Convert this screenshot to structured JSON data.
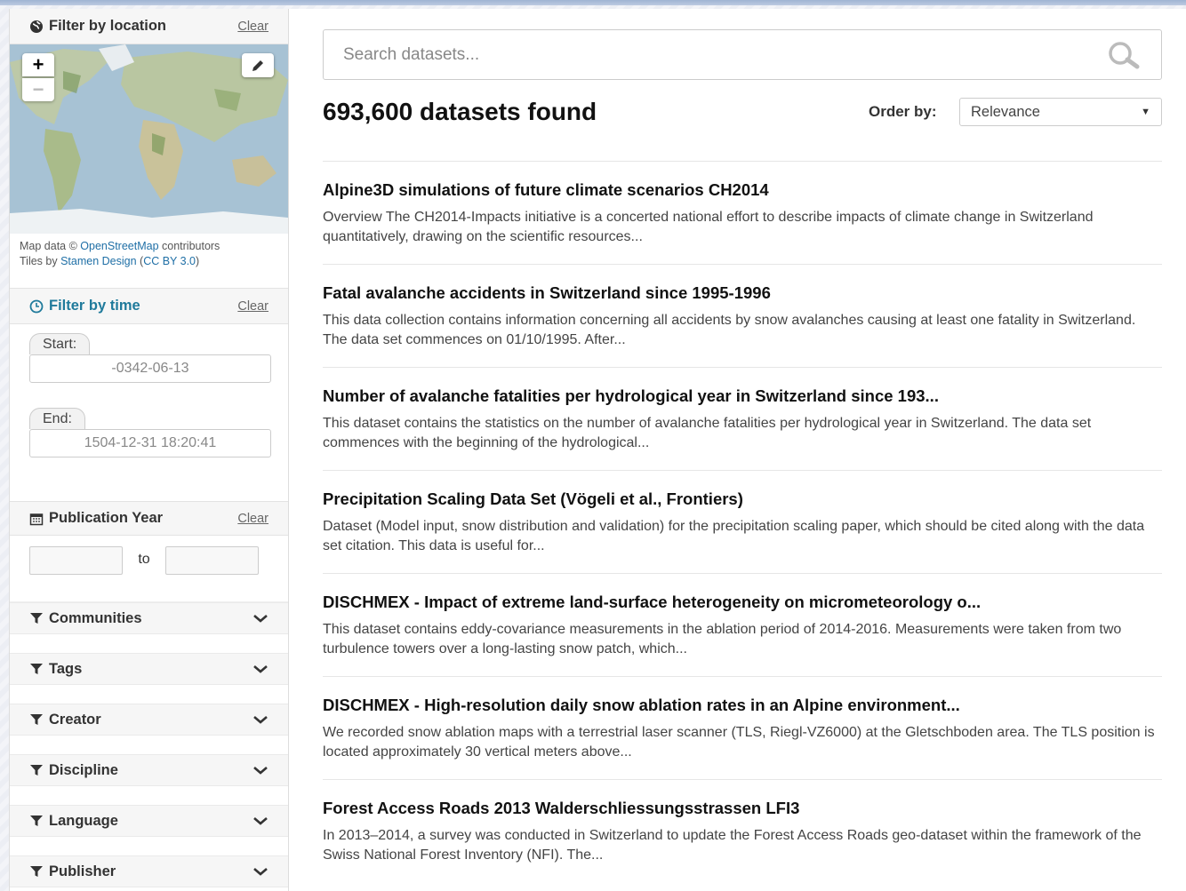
{
  "sidebar": {
    "location": {
      "title": "Filter by location",
      "clear": "Clear",
      "map": {
        "zoom_in": "+",
        "zoom_out": "−"
      },
      "attribution": {
        "line1_pre": "Map data © ",
        "osm": "OpenStreetMap",
        "line1_post": " contributors",
        "line2_pre": "Tiles by ",
        "stamen": "Stamen Design",
        "paren_open": " (",
        "license": "CC BY 3.0",
        "paren_close": ")"
      }
    },
    "time": {
      "title": "Filter by time",
      "clear": "Clear",
      "start_label": "Start:",
      "start_value": "-0342-06-13",
      "end_label": "End:",
      "end_value": "1504-12-31 18:20:41"
    },
    "publication": {
      "title": "Publication Year",
      "clear": "Clear",
      "to": "to"
    },
    "facets": [
      {
        "label": "Communities"
      },
      {
        "label": "Tags"
      },
      {
        "label": "Creator"
      },
      {
        "label": "Discipline"
      },
      {
        "label": "Language"
      },
      {
        "label": "Publisher"
      }
    ]
  },
  "main": {
    "search_placeholder": "Search datasets...",
    "found": "693,600 datasets found",
    "order_label": "Order by:",
    "order_value": "Relevance",
    "results": [
      {
        "title": "Alpine3D simulations of future climate scenarios CH2014",
        "desc": "Overview The CH2014-Impacts initiative is a concerted national effort to describe impacts of climate change in Switzerland quantitatively, drawing on the scientific resources..."
      },
      {
        "title": "Fatal avalanche accidents in Switzerland since 1995-1996",
        "desc": "This data collection contains information concerning all accidents by snow avalanches causing at least one fatality in Switzerland. The data set commences on 01/10/1995. After..."
      },
      {
        "title": "Number of avalanche fatalities per hydrological year in Switzerland since 193...",
        "desc": "This dataset contains the statistics on the number of avalanche fatalities per hydrological year in Switzerland. The data set commences with the beginning of the hydrological..."
      },
      {
        "title": "Precipitation Scaling Data Set (Vögeli et al., Frontiers)",
        "desc": "Dataset (Model input, snow distribution and validation) for the precipitation scaling paper, which should be cited along with the data set citation. This data is useful for..."
      },
      {
        "title": "DISCHMEX - Impact of extreme land-surface heterogeneity on micrometeorology o...",
        "desc": "This dataset contains eddy-covariance measurements in the ablation period of 2014-2016. Measurements were taken from two turbulence towers over a long-lasting snow patch, which..."
      },
      {
        "title": "DISCHMEX - High-resolution daily snow ablation rates in an Alpine environment...",
        "desc": "We recorded snow ablation maps with a terrestrial laser scanner (TLS, Riegl-VZ6000) at the Gletschboden area. The TLS position is located approximately 30 vertical meters above..."
      },
      {
        "title": "Forest Access Roads 2013 Walderschliessungsstrassen LFI3",
        "desc": "In 2013–2014, a survey was conducted in Switzerland to update the Forest Access Roads geo-dataset within the framework of the Swiss National Forest Inventory (NFI). The..."
      }
    ]
  }
}
